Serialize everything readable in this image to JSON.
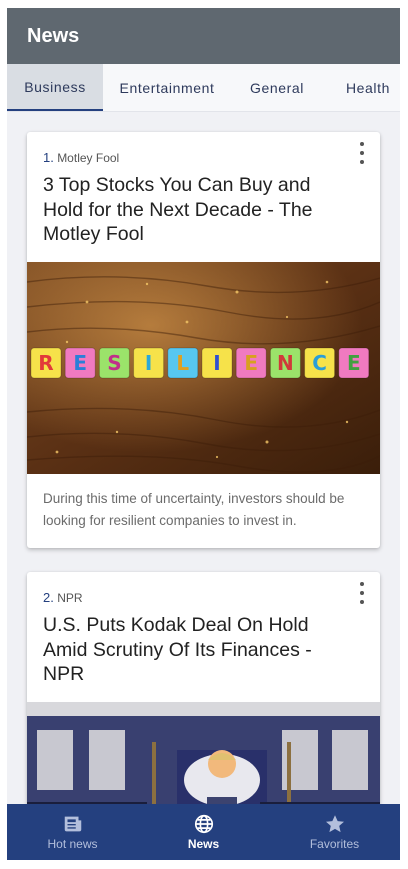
{
  "app": {
    "title": "News"
  },
  "tabs": [
    {
      "label": "Business",
      "active": true
    },
    {
      "label": "Entertainment",
      "active": false
    },
    {
      "label": "General",
      "active": false
    },
    {
      "label": "Health",
      "active": false
    }
  ],
  "articles": [
    {
      "index": "1.",
      "source": "Motley Fool",
      "title": "3 Top Stocks You Can Buy and Hold for the Next Decade - The Motley Fool",
      "image_icon": "resilience-blocks-image",
      "image_letters": [
        "R",
        "E",
        "S",
        "I",
        "L",
        "I",
        "E",
        "N",
        "C",
        "E"
      ],
      "description": "During this time of uncertainty, investors should be looking for resilient companies to invest in."
    },
    {
      "index": "2.",
      "source": "NPR",
      "title": "U.S. Puts Kodak Deal On Hold Amid Scrutiny Of Its Finances - NPR",
      "image_icon": "white-house-briefing-image",
      "image_letters": []
    }
  ],
  "bottom_nav": [
    {
      "label": "Hot news",
      "icon": "newspaper-icon",
      "active": false
    },
    {
      "label": "News",
      "icon": "globe-icon",
      "active": true
    },
    {
      "label": "Favorites",
      "icon": "star-icon",
      "active": false
    }
  ],
  "colors": {
    "appbar": "#5f6870",
    "accent": "#24407f",
    "background": "#f0f1f5"
  }
}
